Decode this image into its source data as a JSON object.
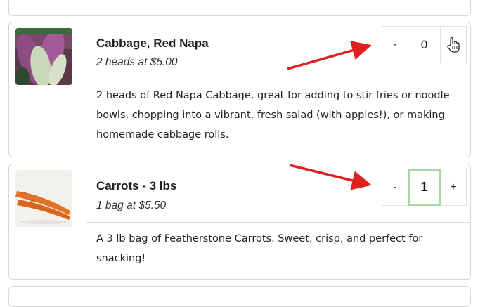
{
  "products": [
    {
      "title": "Cabbage, Red Napa",
      "subtitle": "2 heads at $5.00",
      "description": "2 heads of Red Napa Cabbage, great for adding to stir fries or noodle bowls, chopping into a vibrant, fresh salad (with apples!), or making homemade cabbage rolls.",
      "quantity": "0",
      "minus_label": "-",
      "plus_label": "+"
    },
    {
      "title": "Carrots - 3 lbs",
      "subtitle": "1 bag at $5.50",
      "description": "A 3 lb bag of Featherstone Carrots. Sweet, crisp, and perfect for snacking!",
      "quantity": "1",
      "minus_label": "-",
      "plus_label": "+"
    }
  ],
  "colors": {
    "arrow": "#e02020",
    "focus_border": "#a8d8a8",
    "card_border": "#d6d6d6"
  }
}
